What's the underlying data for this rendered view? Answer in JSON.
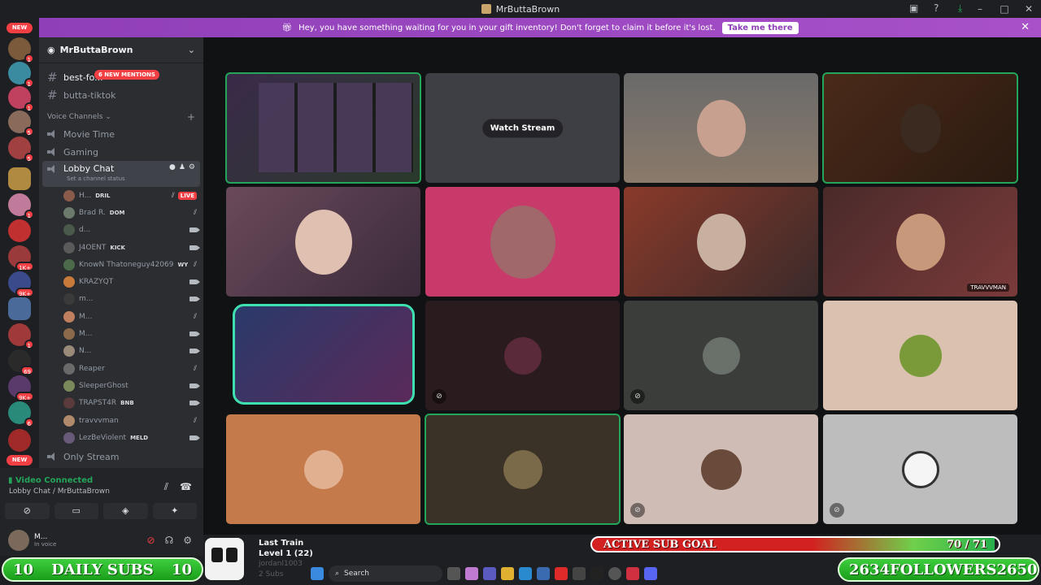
{
  "window": {
    "title": "MrButtaBrown"
  },
  "banner": {
    "text": "Hey, you have something waiting for you in your gift inventory! Don't forget to claim it before it's lost.",
    "button": "Take me there"
  },
  "rail": {
    "new_top": "NEW",
    "new_bottom": "NEW",
    "badges": [
      "1",
      "1",
      "1",
      "5",
      "5",
      "1",
      "1",
      "1K+",
      "9K+",
      "1",
      "69",
      "9K+",
      "6"
    ]
  },
  "server": {
    "name": "MrButtaBrown"
  },
  "channels": {
    "text1": "best-fo...",
    "mentions": "6 NEW MENTIONS",
    "text2": "butta-tiktok",
    "voice_category": "Voice Channels",
    "movie": "Movie Time",
    "gaming": "Gaming",
    "lobby": "Lobby Chat",
    "lobby_status": "Set a channel status",
    "only_stream": "Only Stream"
  },
  "users": [
    {
      "name": "H...",
      "tag": "DRIL",
      "color": "#8a5a4a",
      "live": "LIVE"
    },
    {
      "name": "Brad R.",
      "tag": "DOM",
      "color": "#6b7a6b"
    },
    {
      "name": "d...",
      "tag": "",
      "color": "#4a5a4a"
    },
    {
      "name": "J4OENT",
      "tag": "KICK",
      "color": "#5a5a5a"
    },
    {
      "name": "KnowN Thatoneguy42069",
      "tag": "WY",
      "color": "#4a6a4a"
    },
    {
      "name": "KRAZYQT",
      "tag": "",
      "color": "#c87a3a"
    },
    {
      "name": "m...",
      "tag": "",
      "color": "#3a3a3a"
    },
    {
      "name": "M...",
      "tag": "",
      "color": "#c08060"
    },
    {
      "name": "M...",
      "tag": "",
      "color": "#8a6a4a"
    },
    {
      "name": "N...",
      "tag": "",
      "color": "#9a8a7a"
    },
    {
      "name": "Reaper",
      "tag": "",
      "color": "#6a6a6a"
    },
    {
      "name": "SleeperGhost",
      "tag": "",
      "color": "#7a8a5a"
    },
    {
      "name": "TRAPST4R",
      "tag": "BNB",
      "color": "#5a3a3a"
    },
    {
      "name": "travvvman",
      "tag": "",
      "color": "#b08a6a"
    },
    {
      "name": "LezBeViolent",
      "tag": "MELD",
      "color": "#6a5a7a"
    }
  ],
  "voice": {
    "status": "Video Connected",
    "channel": "Lobby Chat / MrButtaBrown",
    "me_name": "M...",
    "me_status": "In voice"
  },
  "grid": {
    "watch": "Watch Stream",
    "travvv": "TRAVVVMAN"
  },
  "overlay": {
    "daily_label": "DAILY SUBS",
    "daily_left": "10",
    "daily_right": "10",
    "sub_goal": "ACTIVE SUB GOAL",
    "sub_goal_count": "70 / 71",
    "followers_label": "FOLLOWERS",
    "followers_left": "2634",
    "followers_right": "2650",
    "train_title": "Last Train",
    "train_level": "Level 1  (22)",
    "train_user": "jordanl1003",
    "train_subs": "2 Subs",
    "search": "Search"
  },
  "sub_goal_progress": 0.986,
  "colors": {
    "banner": "#a851c9",
    "green": "#23a55a",
    "red": "#f23f43"
  }
}
